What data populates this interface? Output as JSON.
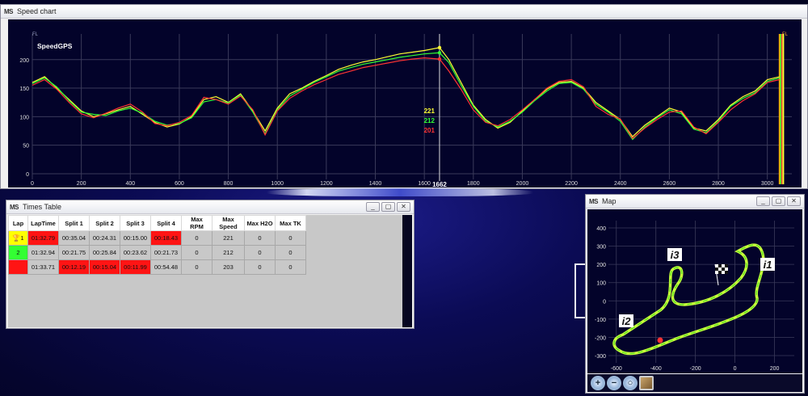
{
  "speed_window": {
    "title": "Speed chart",
    "logo": "MS",
    "buttons": [
      "_",
      "▢",
      "✕"
    ]
  },
  "times_window": {
    "title": "Times Table",
    "logo": "MS",
    "buttons": [
      "_",
      "▢",
      "✕"
    ],
    "columns": [
      "Lap",
      "LapTime",
      "Split 1",
      "Split 2",
      "Split 3",
      "Split 4",
      "Max RPM",
      "Max Speed",
      "Max H2O",
      "Max TK"
    ],
    "rows": [
      {
        "lap": "1",
        "color": "#ffff00",
        "trophy": true,
        "cells": [
          "01:32.79",
          "00:35.04",
          "00:24.31",
          "00:15.00",
          "00:18.43",
          "0",
          "221",
          "0",
          "0"
        ],
        "best": [
          0,
          4
        ]
      },
      {
        "lap": "2",
        "color": "#33ff33",
        "trophy": false,
        "cells": [
          "01:32.94",
          "00:21.75",
          "00:25.84",
          "00:23.62",
          "00:21.73",
          "0",
          "212",
          "0",
          "0"
        ],
        "best": []
      },
      {
        "lap": "",
        "color": "#ff1414",
        "trophy": false,
        "cells": [
          "01:33.71",
          "00:12.19",
          "00:15.04",
          "00:11.99",
          "00:54.48",
          "0",
          "203",
          "0",
          "0"
        ],
        "best": [
          1,
          2,
          3
        ]
      }
    ]
  },
  "map_window": {
    "title": "Map",
    "logo": "MS",
    "buttons": [
      "_",
      "▢",
      "✕"
    ],
    "tools": [
      "zoom-in",
      "zoom-out",
      "zoom-fit",
      "photo"
    ],
    "tool_glyphs": [
      "+",
      "−",
      "○",
      ""
    ],
    "sectors": [
      "i1",
      "i2",
      "i3"
    ],
    "y_ticks": [
      "400",
      "300",
      "200",
      "100",
      "0",
      "-100",
      "-200",
      "-300"
    ],
    "x_ticks": [
      "-600",
      "-400",
      "-200",
      "0",
      "200"
    ]
  },
  "chart_data": {
    "type": "line",
    "channel_label": "SpeedGPS",
    "corner_label_left": "FL",
    "corner_label_right": "FL",
    "xlim": [
      0,
      3100
    ],
    "ylim": [
      -10,
      245
    ],
    "x_ticks": [
      0,
      200,
      400,
      600,
      800,
      1000,
      1200,
      1400,
      1600,
      1800,
      2000,
      2200,
      2400,
      2600,
      2800,
      3000
    ],
    "y_ticks": [
      0,
      50,
      100,
      150,
      200
    ],
    "cursor_x": 1662,
    "cursor_values": [
      "221",
      "212",
      "201"
    ],
    "cursor_colors": [
      "#ffff33",
      "#33ff33",
      "#ff3333"
    ],
    "end_markers": [
      3050,
      3065
    ],
    "series": [
      {
        "color": "#ffff33",
        "x": [
          0,
          50,
          100,
          150,
          200,
          250,
          300,
          350,
          400,
          450,
          500,
          550,
          600,
          650,
          700,
          750,
          800,
          850,
          900,
          950,
          1000,
          1050,
          1100,
          1150,
          1200,
          1250,
          1300,
          1350,
          1400,
          1450,
          1500,
          1550,
          1600,
          1662,
          1700,
          1750,
          1800,
          1850,
          1900,
          1950,
          2000,
          2050,
          2100,
          2150,
          2200,
          2250,
          2300,
          2350,
          2400,
          2450,
          2500,
          2550,
          2600,
          2650,
          2700,
          2750,
          2800,
          2850,
          2900,
          2950,
          3000,
          3050
        ],
        "values": [
          160,
          170,
          150,
          130,
          110,
          100,
          105,
          112,
          118,
          104,
          90,
          82,
          87,
          100,
          130,
          135,
          125,
          140,
          110,
          75,
          115,
          140,
          150,
          162,
          172,
          183,
          190,
          196,
          200,
          205,
          210,
          213,
          216,
          221,
          200,
          160,
          120,
          95,
          80,
          90,
          110,
          130,
          148,
          160,
          162,
          150,
          125,
          110,
          95,
          65,
          85,
          100,
          115,
          108,
          80,
          75,
          95,
          120,
          135,
          145,
          165,
          170
        ]
      },
      {
        "color": "#33ff33",
        "x": [
          0,
          50,
          100,
          150,
          200,
          250,
          300,
          350,
          400,
          450,
          500,
          550,
          600,
          650,
          700,
          750,
          800,
          850,
          900,
          950,
          1000,
          1050,
          1100,
          1150,
          1200,
          1250,
          1300,
          1350,
          1400,
          1450,
          1500,
          1550,
          1600,
          1662,
          1700,
          1750,
          1800,
          1850,
          1900,
          1950,
          2000,
          2050,
          2100,
          2150,
          2200,
          2250,
          2300,
          2350,
          2400,
          2450,
          2500,
          2550,
          2600,
          2650,
          2700,
          2750,
          2800,
          2850,
          2900,
          2950,
          3000,
          3050
        ],
        "values": [
          158,
          168,
          152,
          128,
          108,
          104,
          102,
          110,
          115,
          106,
          92,
          85,
          88,
          98,
          126,
          130,
          124,
          138,
          108,
          70,
          112,
          136,
          148,
          160,
          170,
          180,
          186,
          192,
          196,
          200,
          204,
          207,
          210,
          212,
          195,
          155,
          118,
          92,
          82,
          92,
          108,
          128,
          145,
          158,
          160,
          148,
          122,
          108,
          92,
          60,
          82,
          98,
          112,
          105,
          78,
          72,
          92,
          118,
          132,
          142,
          162,
          168
        ]
      },
      {
        "color": "#ff3333",
        "x": [
          0,
          50,
          100,
          150,
          200,
          250,
          300,
          350,
          400,
          450,
          500,
          550,
          600,
          650,
          700,
          750,
          800,
          850,
          900,
          950,
          1000,
          1050,
          1100,
          1150,
          1200,
          1250,
          1300,
          1350,
          1400,
          1450,
          1500,
          1550,
          1600,
          1662,
          1700,
          1750,
          1800,
          1850,
          1900,
          1950,
          2000,
          2050,
          2100,
          2150,
          2200,
          2250,
          2300,
          2350,
          2400,
          2450,
          2500,
          2550,
          2600,
          2650,
          2700,
          2750,
          2800,
          2850,
          2900,
          2950,
          3000,
          3050
        ],
        "values": [
          155,
          165,
          148,
          125,
          105,
          98,
          106,
          115,
          122,
          108,
          88,
          84,
          90,
          102,
          134,
          130,
          122,
          136,
          112,
          68,
          110,
          132,
          145,
          156,
          165,
          174,
          180,
          186,
          190,
          194,
          198,
          201,
          203,
          201,
          180,
          148,
          112,
          90,
          84,
          95,
          112,
          130,
          150,
          162,
          165,
          152,
          118,
          104,
          96,
          62,
          80,
          95,
          108,
          110,
          82,
          70,
          90,
          112,
          128,
          140,
          160,
          165
        ]
      }
    ]
  }
}
